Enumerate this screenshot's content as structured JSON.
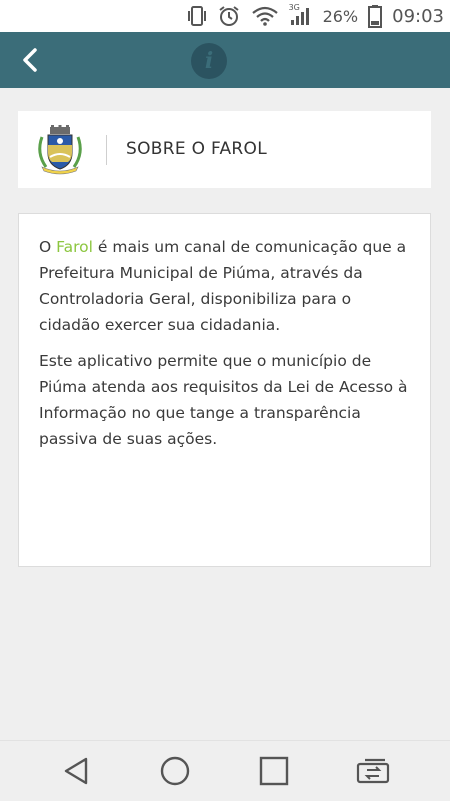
{
  "status_bar": {
    "network": "3G",
    "battery": "26%",
    "time": "09:03",
    "icons": [
      "vibrate-icon",
      "alarm-icon",
      "wifi-icon",
      "signal-icon",
      "battery-icon"
    ]
  },
  "app_bar": {
    "back_icon": "back-chevron-icon",
    "info_icon": "info-icon",
    "info_glyph": "i",
    "color": "#3b6d79"
  },
  "header": {
    "title": "SOBRE O FAROL"
  },
  "content": {
    "p1_prefix": "O ",
    "p1_highlight": "Farol",
    "p1_rest": " é mais um canal de comunicação que a Prefeitura Municipal de Piúma, através da Controladoria Geral, disponibiliza para o cidadão exercer sua cidadania.",
    "p2": "Este aplicativo permite que o município de Piúma atenda aos requisitos da Lei de Acesso à Informação no que tange a transparência passiva de suas ações.",
    "highlight_color": "#8cc63f"
  },
  "nav_bar": {
    "buttons": [
      "back-triangle-icon",
      "home-circle-icon",
      "recents-square-icon",
      "switch-screen-icon"
    ]
  }
}
